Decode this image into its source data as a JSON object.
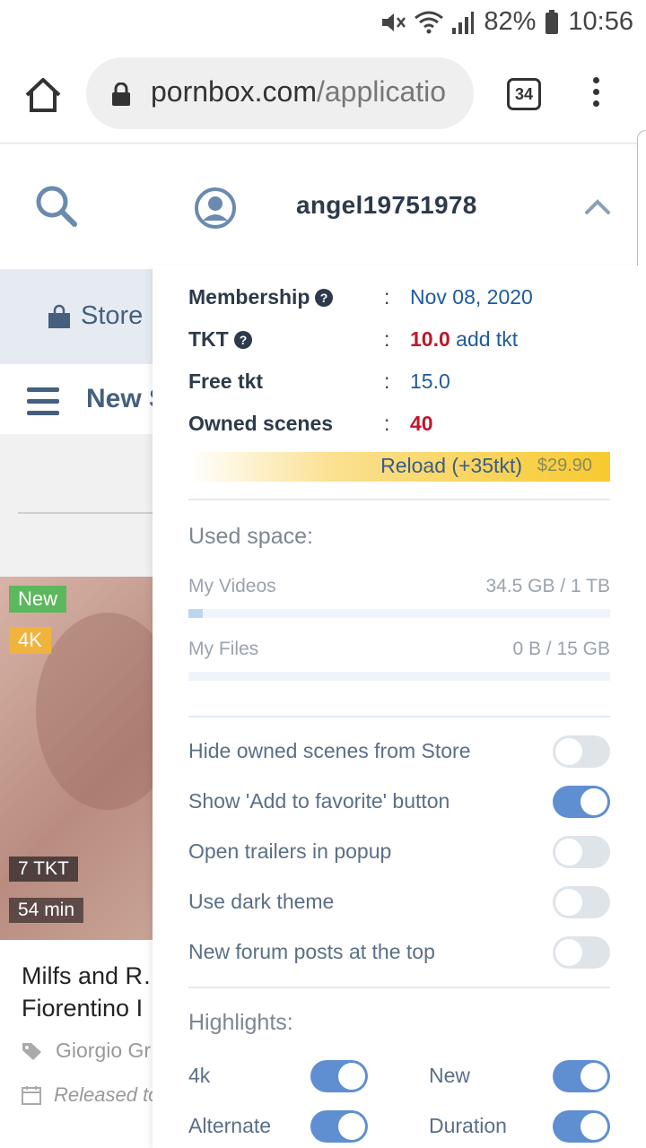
{
  "status_bar": {
    "battery": "82%",
    "time": "10:56"
  },
  "browser": {
    "url_domain": "pornbox.com",
    "url_path": "/applicatio",
    "tab_count": "34"
  },
  "header": {
    "username": "angel19751978"
  },
  "background_page": {
    "store_tab": "Store",
    "nav_title": "New S",
    "card": {
      "badge_new": "New",
      "badge_quality": "4K",
      "price": "7 TKT",
      "duration": "54 min",
      "title": "Milfs and R… Fiorentino I",
      "actor": "Giorgio Gr",
      "release": "Released to"
    }
  },
  "account": {
    "rows": [
      {
        "label": "Membership",
        "colon": ":",
        "value": "Nov 08, 2020"
      },
      {
        "label": "TKT",
        "colon": ":",
        "value_emph": "10.0",
        "value_link": "add tkt"
      },
      {
        "label": "Free tkt",
        "colon": ":",
        "value": "15.0"
      },
      {
        "label": "Owned scenes",
        "colon": ":",
        "value_emph": "40"
      }
    ],
    "reload": {
      "label": "Reload (+35tkt)",
      "price": "$29.90"
    }
  },
  "storage": {
    "title": "Used space:",
    "videos": {
      "label": "My Videos",
      "usage": "34.5 GB / 1 TB",
      "fraction": 0.034
    },
    "files": {
      "label": "My Files",
      "usage": "0 B / 15 GB",
      "fraction": 0
    }
  },
  "settings": [
    {
      "label": "Hide owned scenes from Store",
      "on": false
    },
    {
      "label": "Show 'Add to favorite' button",
      "on": true
    },
    {
      "label": "Open trailers in popup",
      "on": false
    },
    {
      "label": "Use dark theme",
      "on": false
    },
    {
      "label": "New forum posts at the top",
      "on": false
    }
  ],
  "highlights": {
    "title": "Highlights:",
    "items": [
      {
        "label": "4k",
        "on": true
      },
      {
        "label": "New",
        "on": true
      },
      {
        "label": "Alternate",
        "on": true
      },
      {
        "label": "Duration",
        "on": true
      }
    ]
  },
  "colors": {
    "accent": "#5f8fd0",
    "link": "#1f5b9c",
    "emphasis": "#c0152a",
    "reload": "#f7ca2f"
  }
}
